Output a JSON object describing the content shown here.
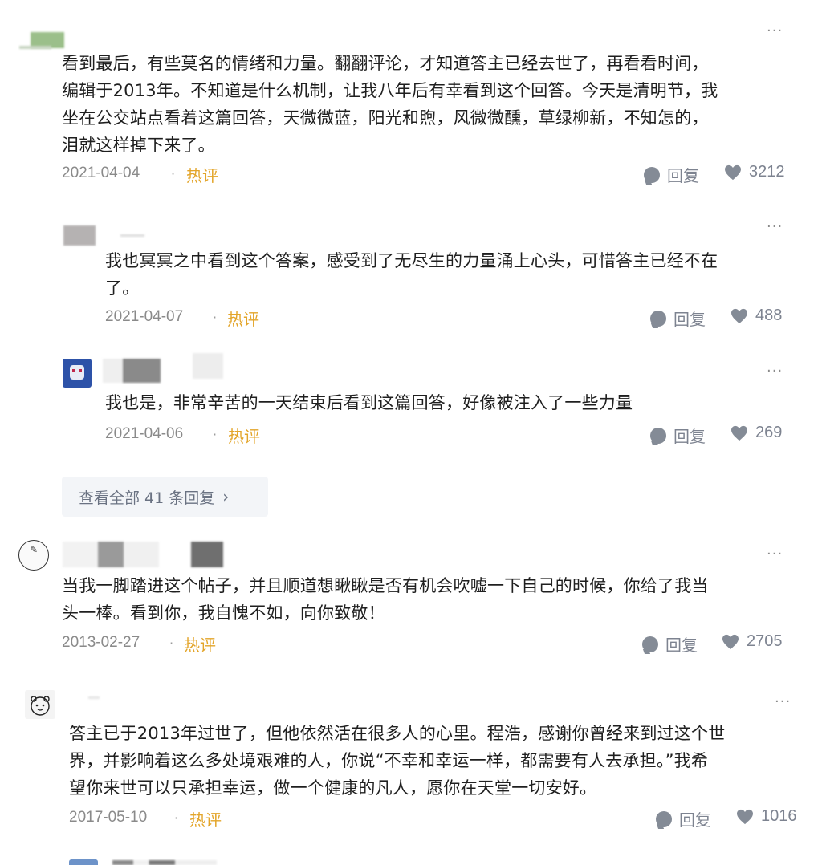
{
  "comments": [
    {
      "text": "看到最后，有些莫名的情绪和力量。翻翻评论，才知道答主已经去世了，再看看时间，\n编辑于2013年。不知道是什么机制，让我八年后有幸看到这个回答。今天是清明节，我\n坐在公交站点看着这篇回答，天微微蓝，阳光和煦，风微微醺，草绿柳新，不知怎的，\n泪就这样掉下来了。",
      "date": "2021-04-04",
      "tag": "热评",
      "reply_label": "回复",
      "likes": "3212"
    },
    {
      "text": "我也冥冥之中看到这个答案，感受到了无尽生的力量涌上心头，可惜答主已经不在\n了。",
      "date": "2021-04-07",
      "tag": "热评",
      "reply_label": "回复",
      "likes": "488"
    },
    {
      "text": "我也是，非常辛苦的一天结束后看到这篇回答，好像被注入了一些力量",
      "date": "2021-04-06",
      "tag": "热评",
      "reply_label": "回复",
      "likes": "269"
    },
    {
      "text": "当我一脚踏进这个帖子，并且顺道想瞅瞅是否有机会吹嘘一下自己的时候，你给了我当\n头一棒。看到你，我自愧不如，向你致敬！",
      "date": "2013-02-27",
      "tag": "热评",
      "reply_label": "回复",
      "likes": "2705"
    },
    {
      "text": "答主已于2013年过世了，但他依然活在很多人的心里。程浩，感谢你曾经来到过这个世\n界，并影响着这么多处境艰难的人，你说“不幸和幸运一样，都需要有人去承担。”我希\n望你来世可以只承担幸运，做一个健康的凡人，愿你在天堂一切安好。",
      "date": "2017-05-10",
      "tag": "热评",
      "reply_label": "回复",
      "likes": "1016"
    }
  ],
  "view_all_replies": "查看全部 41 条回复",
  "more_icon": "···",
  "separator": "·",
  "colors": {
    "hot": "#e3a52a",
    "meta": "#8a8a8a",
    "icon": "#848b96",
    "view_all_bg": "#f3f5f8"
  }
}
